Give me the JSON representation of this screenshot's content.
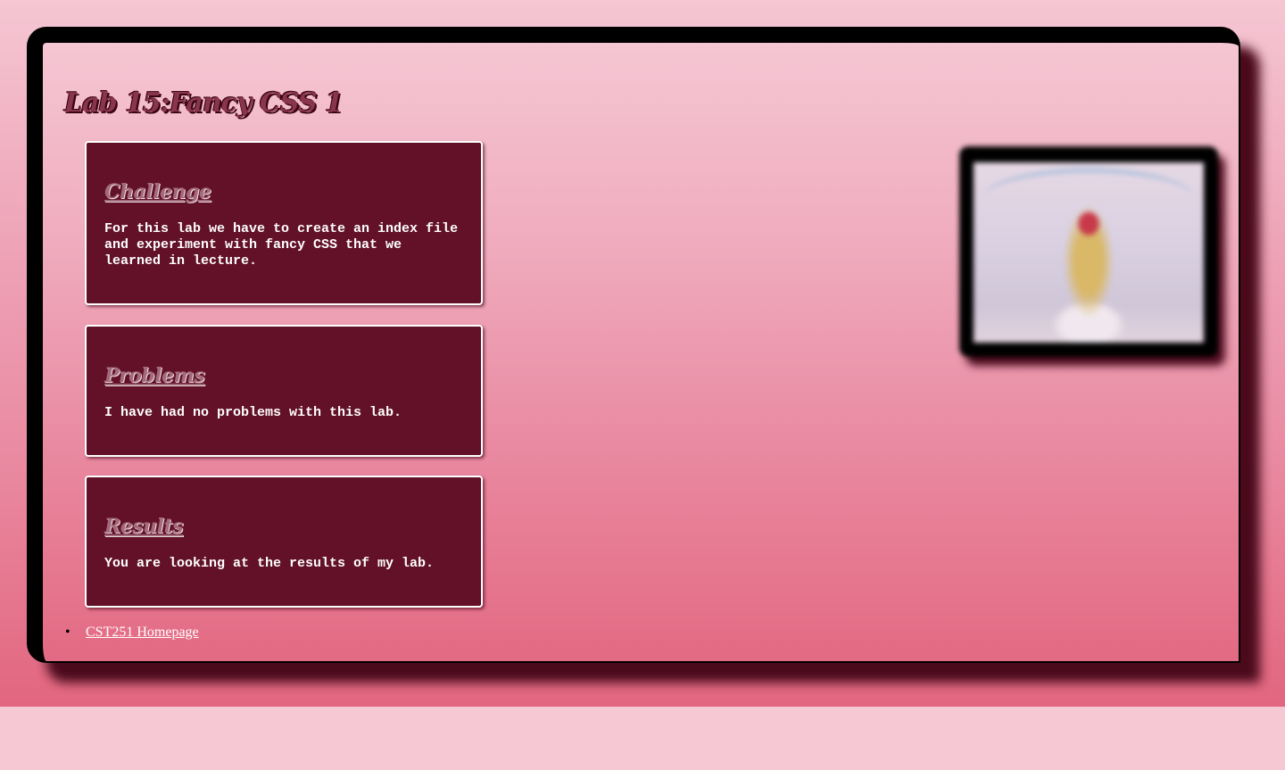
{
  "page": {
    "title": "Lab 15:Fancy CSS 1"
  },
  "sections": [
    {
      "heading": "Challenge",
      "body": "For this lab we have to create an index file and experiment with fancy CSS that we learned in lecture."
    },
    {
      "heading": "Problems",
      "body": "I have had no problems with this lab."
    },
    {
      "heading": "Results",
      "body": "You are looking at the results of my lab."
    }
  ],
  "links": [
    {
      "bullet": "•",
      "label": "CST251 Homepage"
    }
  ],
  "colors": {
    "card_background": "#621128",
    "frame_border": "#000000",
    "frame_shadow": "#4a0a1c",
    "link": "#ffffff"
  },
  "icons": {
    "photo": "anime-character-image"
  }
}
